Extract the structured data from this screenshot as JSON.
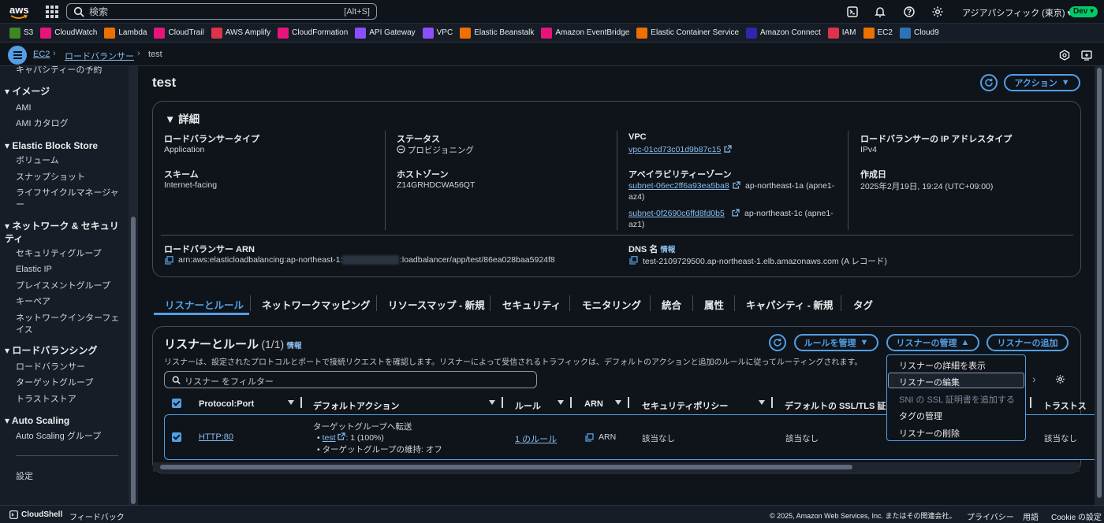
{
  "topnav": {
    "logo_text": "aws",
    "search_placeholder": "検索",
    "search_shortcut": "[Alt+S]",
    "region": "アジアパシフィック (東京) ▾",
    "account_badge": "Dev ▾"
  },
  "favorites": [
    {
      "label": "S3",
      "color": "#3f8624"
    },
    {
      "label": "CloudWatch",
      "color": "#e7157b"
    },
    {
      "label": "Lambda",
      "color": "#ed7100"
    },
    {
      "label": "CloudTrail",
      "color": "#e7157b"
    },
    {
      "label": "AWS Amplify",
      "color": "#dd344c"
    },
    {
      "label": "CloudFormation",
      "color": "#e7157b"
    },
    {
      "label": "API Gateway",
      "color": "#8c4fff"
    },
    {
      "label": "VPC",
      "color": "#8c4fff"
    },
    {
      "label": "Elastic Beanstalk",
      "color": "#ed7100"
    },
    {
      "label": "Amazon EventBridge",
      "color": "#e7157b"
    },
    {
      "label": "Elastic Container Service",
      "color": "#ed7100"
    },
    {
      "label": "Amazon Connect",
      "color": "#2e27ad"
    },
    {
      "label": "IAM",
      "color": "#dd344c"
    },
    {
      "label": "EC2",
      "color": "#ed7100"
    },
    {
      "label": "Cloud9",
      "color": "#2e73b8"
    }
  ],
  "breadcrumb": {
    "ec2": "EC2",
    "lb": "ロードバランサー",
    "current": "test"
  },
  "sidebar": {
    "top_item": "キャパシティーの予約",
    "image_head": "イメージ",
    "ami": "AMI",
    "ami_catalog": "AMI カタログ",
    "ebs_head": "Elastic Block Store",
    "volumes": "ボリューム",
    "snapshots": "スナップショット",
    "lifecycle": "ライフサイクルマネージャー",
    "netsec_head": "ネットワーク & セキュリティ",
    "sg": "セキュリティグループ",
    "eip": "Elastic IP",
    "placement": "プレイスメントグループ",
    "keypair": "キーペア",
    "eni": "ネットワークインターフェイス",
    "lb_head": "ロードバランシング",
    "lb": "ロードバランサー",
    "tg": "ターゲットグループ",
    "trust": "トラストストア",
    "as_head": "Auto Scaling",
    "asg": "Auto Scaling グループ",
    "settings": "設定"
  },
  "page": {
    "title": "test",
    "actions_label": "アクション"
  },
  "details": {
    "heading": "詳細",
    "lb_type_label": "ロードバランサータイプ",
    "lb_type": "Application",
    "scheme_label": "スキーム",
    "scheme": "Internet-facing",
    "status_label": "ステータス",
    "status": "プロビジョニング",
    "zone_label": "ホストゾーン",
    "zone": "Z14GRHDCWA56QT",
    "vpc_label": "VPC",
    "vpc": "vpc-01cd73c01d9b87c15",
    "az_label": "アベイラビリティーゾーン",
    "subnet1": "subnet-06ec2ff6a93ea5ba8",
    "subnet1_az_a": "ap-northeast-1a (apne1-",
    "subnet1_az_b": "az4)",
    "subnet2": "subnet-0f2690c6ffd8fd0b5",
    "subnet2_az_a": "ap-northeast-1c (apne1-",
    "subnet2_az_b": "az1)",
    "ip_type_label": "ロードバランサーの IP アドレスタイプ",
    "ip_type": "IPv4",
    "created_label": "作成日",
    "created": "2025年2月19日, 19:24 (UTC+09:00)",
    "arn_label": "ロードバランサー ARN",
    "arn_prefix": "arn:aws:elasticloadbalancing:ap-northeast-1:",
    "arn_suffix": ":loadbalancer/app/test/86ea028baa5924f8",
    "dns_label": "DNS 名",
    "dns_info": "情報",
    "dns": "test-2109729500.ap-northeast-1.elb.amazonaws.com (A レコード)"
  },
  "tabs": [
    "リスナーとルール",
    "ネットワークマッピング",
    "リソースマップ - 新規",
    "セキュリティ",
    "モニタリング",
    "統合",
    "属性",
    "キャパシティ - 新規",
    "タグ"
  ],
  "listeners": {
    "title": "リスナーとルール",
    "count": "(1/1)",
    "info": "情報",
    "desc": "リスナーは、設定されたプロトコルとポートで接続リクエストを確認します。リスナーによって受信されるトラフィックは、デフォルトのアクションと追加のルールに従ってルーティングされます。",
    "manage_rules": "ルールを管理",
    "manage_listener": "リスナーの管理",
    "add_listener": "リスナーの追加",
    "filter_placeholder": "リスナー をフィルター",
    "columns": [
      "Protocol:Port",
      "デフォルトアクション",
      "ルール",
      "ARN",
      "セキュリティポリシー",
      "デフォルトの SSL/TLS 証明",
      "トラストス"
    ],
    "row": {
      "protocol": "HTTP:80",
      "action_title": "ターゲットグループへ転送",
      "action_tg": "test",
      "action_weight": ": 1 (100%)",
      "action_sticky": "ターゲットグループの維持: オフ",
      "rules": "1 のルール",
      "arn": "ARN",
      "policy": "該当なし",
      "cert": "該当なし",
      "trust": "該当なし"
    }
  },
  "dropdown": [
    "リスナーの詳細を表示",
    "リスナーの編集",
    "SNI の SSL 証明書を追加する",
    "タグの管理",
    "リスナーの削除"
  ],
  "footer": {
    "cloudshell": "CloudShell",
    "feedback": "フィードバック",
    "copyright": "© 2025, Amazon Web Services, Inc. またはその関連会社。",
    "privacy": "プライバシー",
    "terms": "用語",
    "cookies": "Cookie の設定"
  }
}
